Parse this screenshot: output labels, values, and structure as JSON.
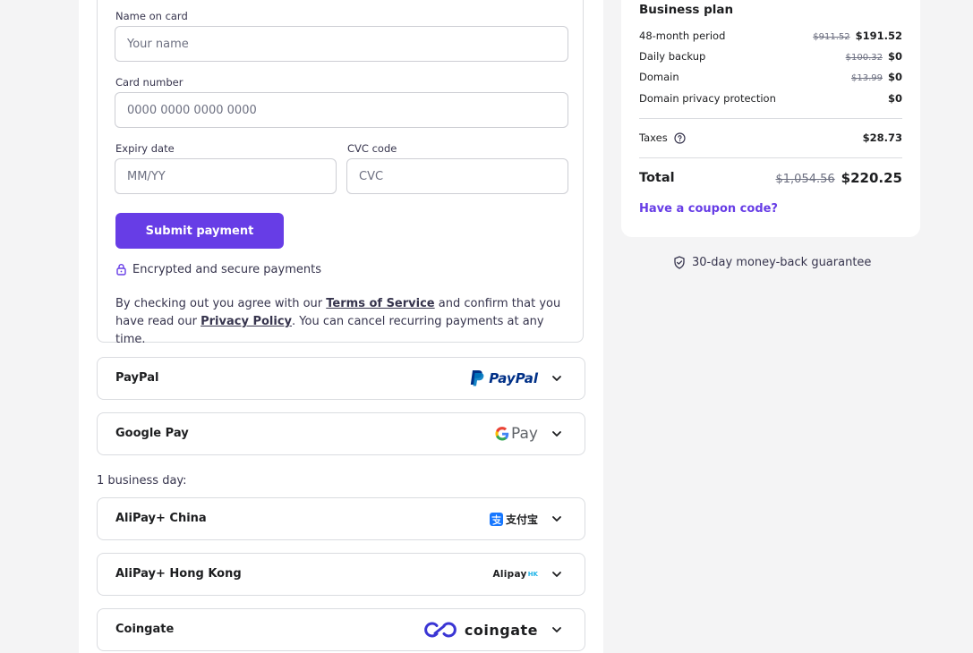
{
  "card_form": {
    "name_label": "Name on card",
    "name_placeholder": "Your name",
    "number_label": "Card number",
    "number_placeholder": "0000 0000 0000 0000",
    "expiry_label": "Expiry date",
    "expiry_placeholder": "MM/YY",
    "cvc_label": "CVC code",
    "cvc_placeholder": "CVC",
    "submit_label": "Submit payment",
    "secure_text": "Encrypted and secure payments",
    "agreement": {
      "text_1": "By checking out you agree with our ",
      "terms_link": "Terms of Service",
      "text_2": " and confirm that you have read our ",
      "privacy_link": "Privacy Policy",
      "text_3": ". You can cancel recurring payments at any time."
    }
  },
  "payment_methods": [
    {
      "name": "PayPal",
      "logo_text": "PayPal",
      "icon": "paypal-logo"
    },
    {
      "name": "Google Pay",
      "logo_text": "Pay",
      "icon": "google-pay-logo"
    },
    {
      "name": "AliPay+ China",
      "logo_text": "支付宝",
      "icon": "alipay-logo"
    },
    {
      "name": "AliPay+ Hong Kong",
      "logo_text": "Alipay",
      "logo_suffix": "HK",
      "icon": "alipayhk-logo"
    },
    {
      "name": "Coingate",
      "logo_text": "coingate",
      "icon": "coingate-logo"
    }
  ],
  "business_day_label": "1 business day:",
  "summary": {
    "title": "Business plan",
    "rows": [
      {
        "label": "48-month period",
        "old": "$911.52",
        "new": "$191.52"
      },
      {
        "label": "Daily backup",
        "old": "$100.32",
        "new": "$0"
      },
      {
        "label": "Domain",
        "old": "$13.99",
        "new": "$0"
      },
      {
        "label": "Domain privacy protection",
        "old": "",
        "new": "$0"
      }
    ],
    "taxes_label": "Taxes",
    "taxes_value": "$28.73",
    "total_label": "Total",
    "total_old": "$1,054.56",
    "total_new": "$220.25",
    "coupon_label": "Have a coupon code?"
  },
  "guarantee_text": "30-day money-back guarantee",
  "colors": {
    "accent": "#673de6",
    "text": "#1d1e20",
    "border": "#dadce0",
    "background": "#f4f4f5"
  }
}
